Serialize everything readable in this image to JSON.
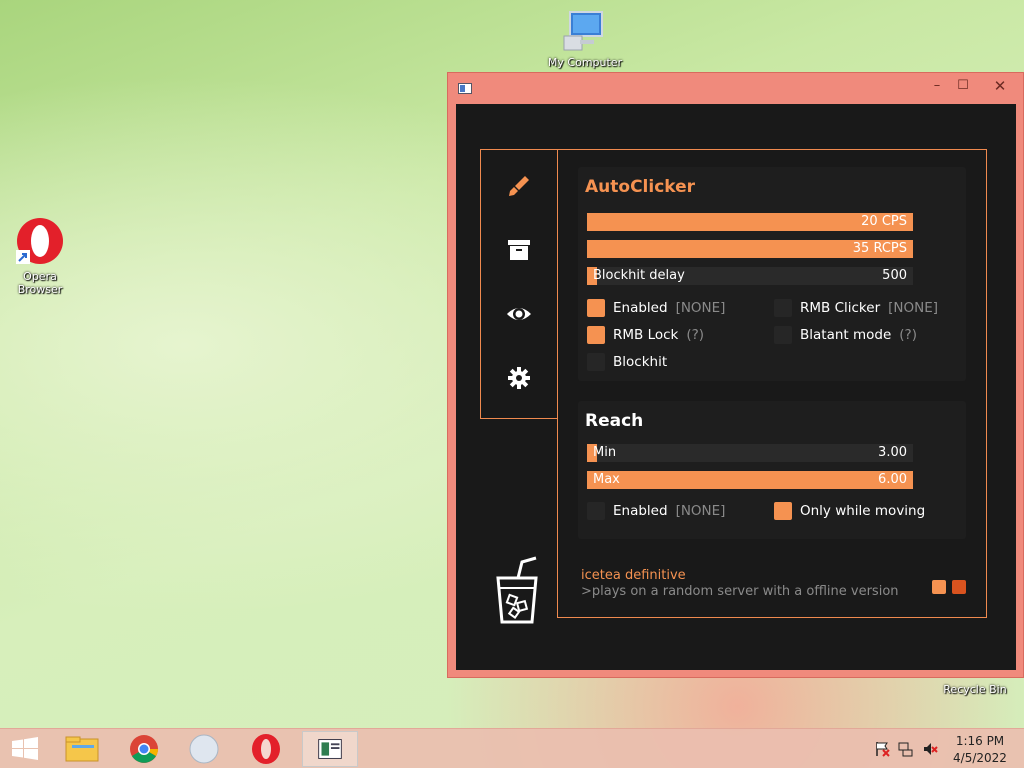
{
  "desktop": {
    "icons": [
      {
        "label": "My Computer"
      },
      {
        "label": "Opera Browser"
      },
      {
        "label": "Recycle Bin"
      }
    ]
  },
  "window": {
    "buttons": {
      "min": "–",
      "max": "☐",
      "close": "✕"
    },
    "sidebar_icons": [
      "brush-icon",
      "archive-icon",
      "eye-icon",
      "gear-icon"
    ],
    "autoclicker": {
      "title": "AutoClicker",
      "sliders": [
        {
          "label": "",
          "value": "20 CPS",
          "fill": 100
        },
        {
          "label": "",
          "value": "35 RCPS",
          "fill": 100
        },
        {
          "label": "Blockhit delay",
          "value": "500",
          "fill": 3
        }
      ],
      "checks": [
        {
          "label": "Enabled",
          "hint": "[NONE]",
          "checked": true
        },
        {
          "label": "RMB Clicker",
          "hint": "[NONE]",
          "checked": false
        },
        {
          "label": "RMB Lock",
          "hint": "(?)",
          "checked": true
        },
        {
          "label": "Blatant mode",
          "hint": "(?)",
          "checked": false
        },
        {
          "label": "Blockhit",
          "hint": "",
          "checked": false
        }
      ]
    },
    "reach": {
      "title": "Reach",
      "sliders": [
        {
          "label": "Min",
          "value": "3.00",
          "fill": 3
        },
        {
          "label": "Max",
          "value": "6.00",
          "fill": 100
        }
      ],
      "checks": [
        {
          "label": "Enabled",
          "hint": "[NONE]",
          "checked": false
        },
        {
          "label": "Only while moving",
          "hint": "",
          "checked": true
        }
      ]
    },
    "footer": {
      "name": "icetea definitive",
      "desc": ">plays on a random server with a offline version"
    }
  },
  "taskbar": {
    "time": "1:16 PM",
    "date": "4/5/2022"
  },
  "colors": {
    "accent": "#f59251",
    "accent_dark": "#d9531f",
    "window_border": "#f08a7c",
    "bg": "#191919"
  }
}
